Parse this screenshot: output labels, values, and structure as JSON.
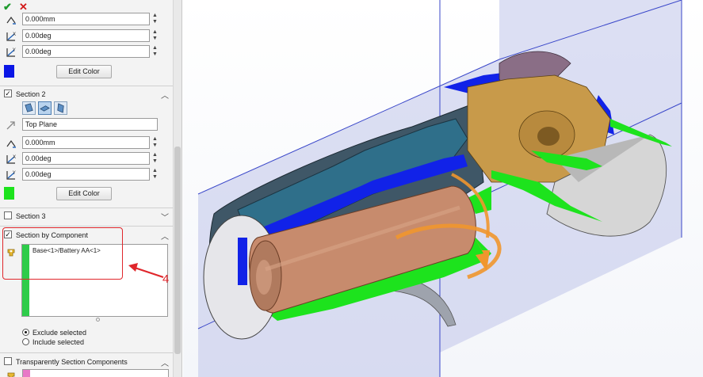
{
  "toolbar": {
    "ok_symbol": "✔",
    "cancel_symbol": "✕"
  },
  "section1": {
    "fields": [
      {
        "icon": "offset-distance-icon",
        "value": "0.000mm"
      },
      {
        "icon": "rotate-x-icon",
        "value": "0.00deg"
      },
      {
        "icon": "rotate-y-icon",
        "value": "0.00deg"
      }
    ],
    "color": "#0a16e6",
    "edit_color_label": "Edit Color"
  },
  "section2": {
    "title": "Section 2",
    "checked": true,
    "plane_buttons": [
      "front-plane-icon",
      "top-plane-icon",
      "right-plane-icon"
    ],
    "reference": "Top Plane",
    "fields": [
      {
        "icon": "offset-distance-icon",
        "value": "0.000mm"
      },
      {
        "icon": "rotate-x-icon",
        "value": "0.00deg"
      },
      {
        "icon": "rotate-y-icon",
        "value": "0.00deg"
      }
    ],
    "color": "#1de31d",
    "edit_color_label": "Edit Color"
  },
  "section3": {
    "title": "Section 3",
    "checked": false
  },
  "section_by_component": {
    "title": "Section by Component",
    "checked": true,
    "items": [
      "Base<1>/Battery AA<1>"
    ],
    "options": [
      {
        "label": "Exclude selected",
        "selected": true
      },
      {
        "label": "Include selected",
        "selected": false
      }
    ]
  },
  "transparent": {
    "title": "Transparently Section Components",
    "checked": false
  },
  "annotation": {
    "callout_number": "4",
    "color": "#e0262b"
  }
}
